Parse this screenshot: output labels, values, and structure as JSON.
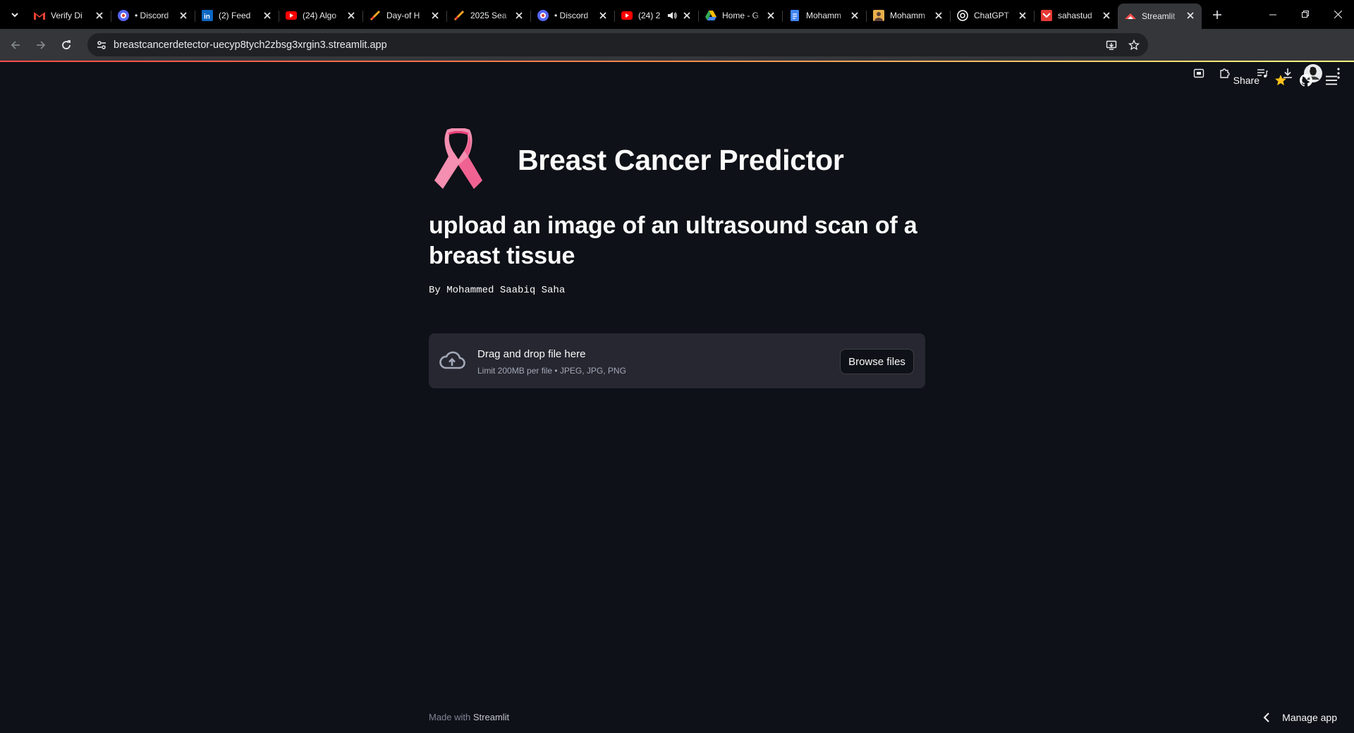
{
  "browser": {
    "tabs": [
      {
        "title": "Verify Di",
        "icon": "gmail-icon",
        "color": "#ea4335"
      },
      {
        "title": "• Discord",
        "icon": "discord-icon",
        "color": "#5865f2"
      },
      {
        "title": "(2) Feed",
        "icon": "linkedin-icon",
        "color": "#0a66c2"
      },
      {
        "title": "(24) Algo",
        "icon": "youtube-icon",
        "color": "#ff0000"
      },
      {
        "title": "Day-of H",
        "icon": "hackathon-icon",
        "color": "#f5a623"
      },
      {
        "title": "2025 Sea",
        "icon": "hackathon-icon",
        "color": "#f5a623"
      },
      {
        "title": "• Discord",
        "icon": "discord-icon",
        "color": "#5865f2"
      },
      {
        "title": "(24) 2",
        "icon": "youtube-icon",
        "color": "#ff0000",
        "audio": true
      },
      {
        "title": "Home - G",
        "icon": "drive-icon",
        "color": "#34a853"
      },
      {
        "title": "Mohamm",
        "icon": "docs-icon",
        "color": "#4285f4"
      },
      {
        "title": "Mohamm",
        "icon": "image-icon",
        "color": "#e8b04b"
      },
      {
        "title": "ChatGPT",
        "icon": "chatgpt-icon",
        "color": "#ffffff"
      },
      {
        "title": "sahastud",
        "icon": "app-icon",
        "color": "#e53935"
      },
      {
        "title": "Streamlit",
        "icon": "streamlit-icon",
        "color": "#ff4b4b",
        "active": true
      }
    ],
    "url": "breastcancerdetector-uecyp8tych2zbsg3xrgin3.streamlit.app"
  },
  "header": {
    "share_label": "Share"
  },
  "app": {
    "title": "Breast Cancer Predictor",
    "subtitle": "upload an image of an ultrasound scan of a breast tissue",
    "byline": "By Mohammed Saabiq Saha",
    "uploader": {
      "main_text": "Drag and drop file here",
      "sub_text": "Limit 200MB per file • JPEG, JPG, PNG",
      "button_label": "Browse files"
    }
  },
  "footer": {
    "made_with": "Made with",
    "brand": "Streamlit",
    "manage_app": "Manage app"
  },
  "colors": {
    "background": "#0e1117",
    "uploader_bg": "#262730",
    "ribbon": "#f48fb1",
    "accent": "#ff4b4b"
  }
}
